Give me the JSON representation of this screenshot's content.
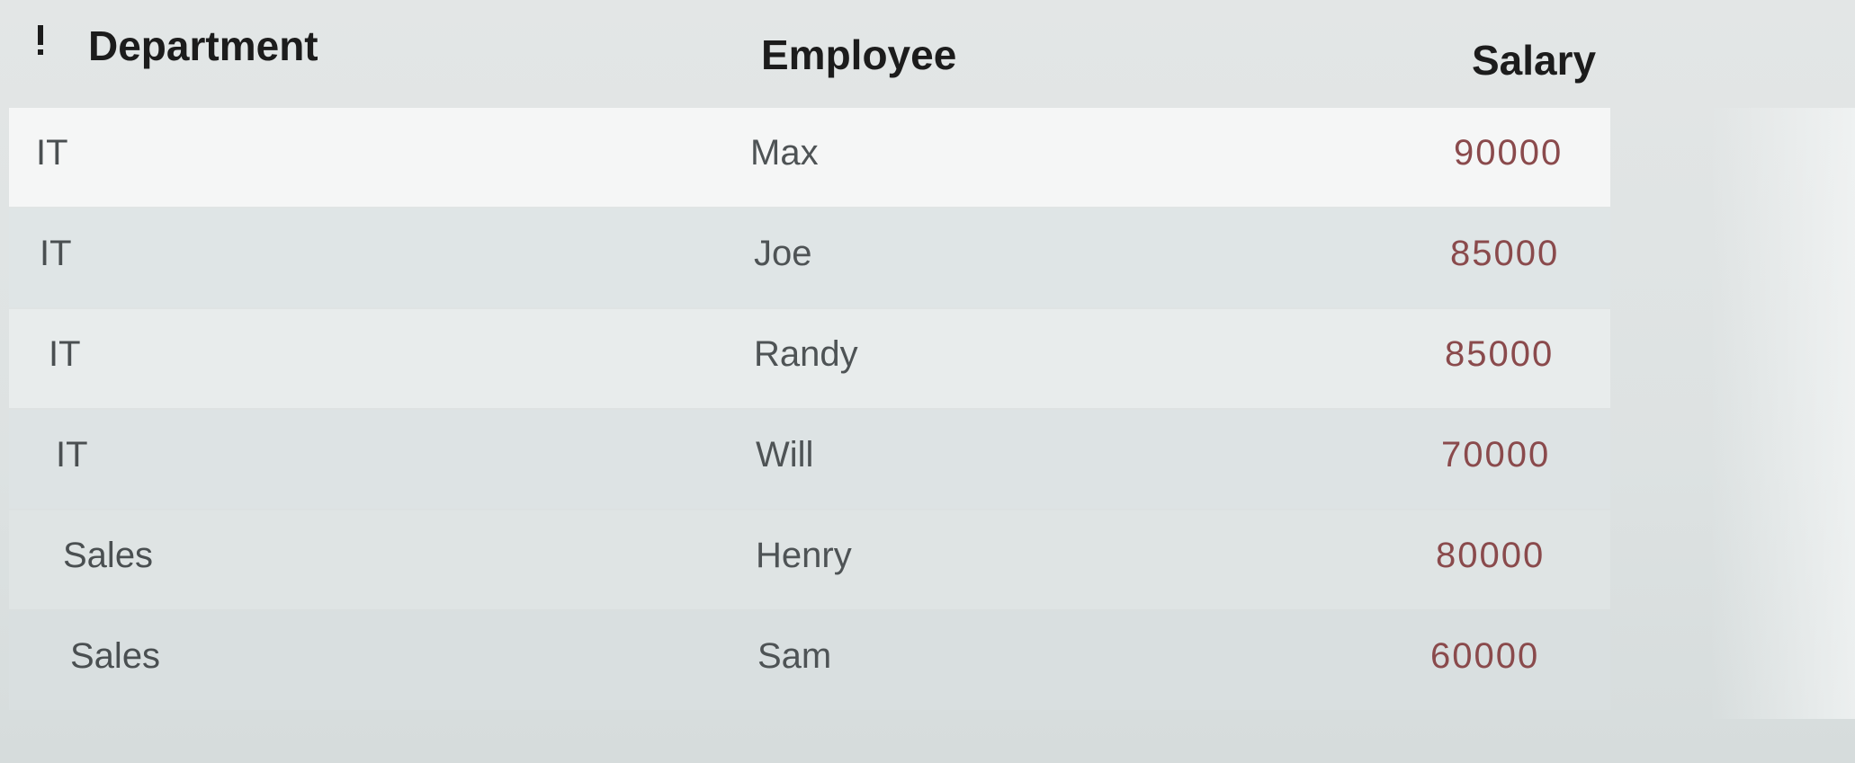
{
  "table": {
    "columns": {
      "department": "Department",
      "employee": "Employee",
      "salary": "Salary"
    },
    "rows": [
      {
        "department": "IT",
        "employee": "Max",
        "salary": "90000"
      },
      {
        "department": "IT",
        "employee": "Joe",
        "salary": "85000"
      },
      {
        "department": "IT",
        "employee": "Randy",
        "salary": "85000"
      },
      {
        "department": "IT",
        "employee": "Will",
        "salary": "70000"
      },
      {
        "department": "Sales",
        "employee": "Henry",
        "salary": "80000"
      },
      {
        "department": "Sales",
        "employee": "Sam",
        "salary": "60000"
      }
    ]
  },
  "icons": {
    "sort": "sort-indicator-icon"
  },
  "colors": {
    "salary_text": "#8a4a4c",
    "header_text": "#1c1c1c"
  }
}
